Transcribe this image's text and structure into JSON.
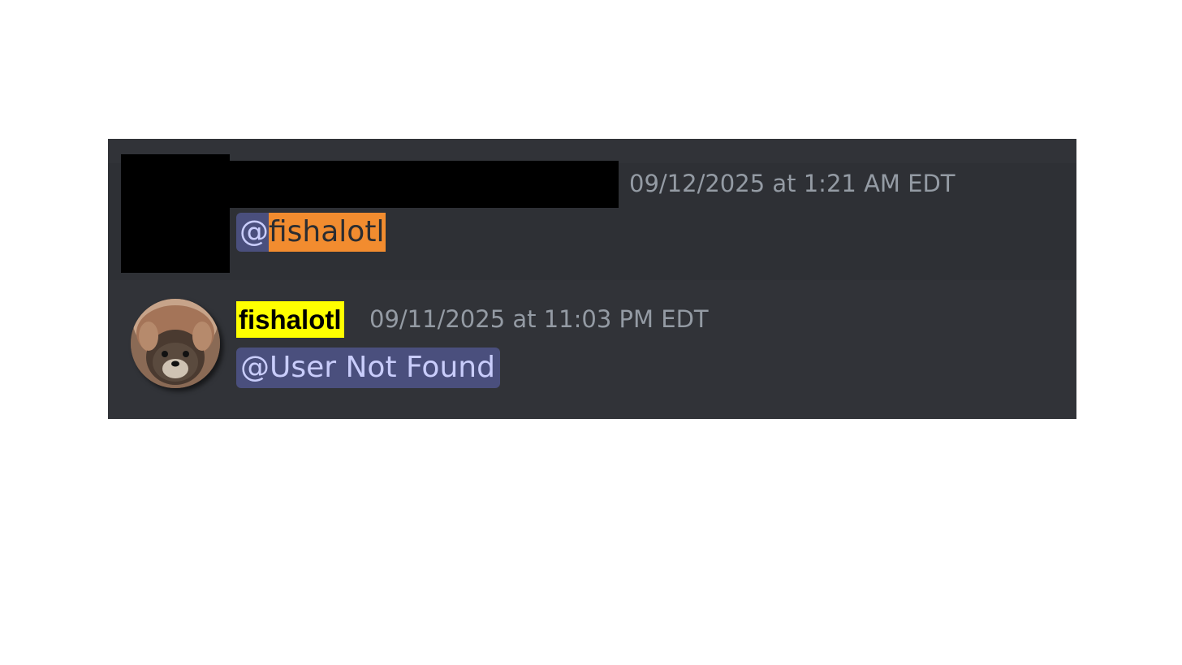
{
  "messages": [
    {
      "author": "",
      "author_redacted": true,
      "timestamp": "09/12/2025 at 1:21 AM EDT",
      "mention_prefix": "@",
      "mention_name": "fishalotl",
      "mention_highlight_color": "#f28c2f"
    },
    {
      "author": "fishalotl",
      "author_highlight_color": "#ffff00",
      "avatar_icon": "otter-avatar-icon",
      "timestamp": "09/11/2025 at 11:03 PM EDT",
      "mention_text": "@User Not Found"
    }
  ],
  "theme": {
    "background": "#313338",
    "mention_background": "#4a4f7d",
    "mention_text": "#c9cdfb",
    "timestamp_color": "#949ba4"
  }
}
